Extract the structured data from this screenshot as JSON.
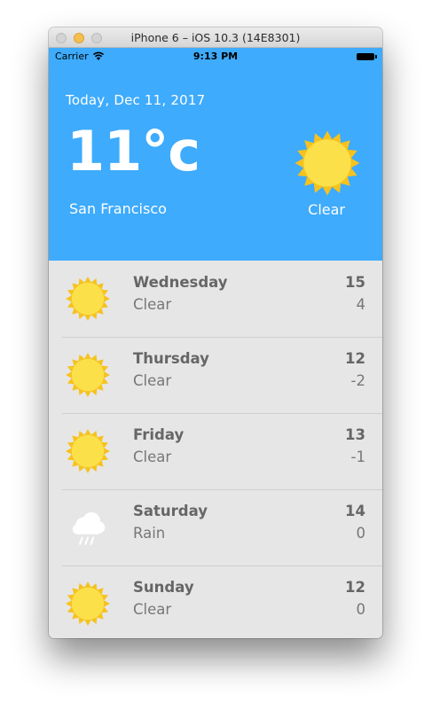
{
  "window": {
    "title": "iPhone 6 – iOS 10.3 (14E8301)"
  },
  "status_bar": {
    "carrier": "Carrier",
    "time": "9:13 PM"
  },
  "today": {
    "date": "Today, Dec 11, 2017",
    "temperature": "11°c",
    "city": "San Francisco",
    "condition": "Clear",
    "icon": "sun-icon"
  },
  "forecast": [
    {
      "day": "Wednesday",
      "condition": "Clear",
      "high": "15",
      "low": "4",
      "icon": "sun-icon"
    },
    {
      "day": "Thursday",
      "condition": "Clear",
      "high": "12",
      "low": "-2",
      "icon": "sun-icon"
    },
    {
      "day": "Friday",
      "condition": "Clear",
      "high": "13",
      "low": "-1",
      "icon": "sun-icon"
    },
    {
      "day": "Saturday",
      "condition": "Rain",
      "high": "14",
      "low": "0",
      "icon": "rain-cloud-icon"
    },
    {
      "day": "Sunday",
      "condition": "Clear",
      "high": "12",
      "low": "0",
      "icon": "sun-icon"
    }
  ],
  "colors": {
    "header_blue": "#3eabfc",
    "list_gray": "#e6e6e6",
    "sun_yellow": "#fbe04a",
    "sun_orange": "#f6c21d"
  }
}
